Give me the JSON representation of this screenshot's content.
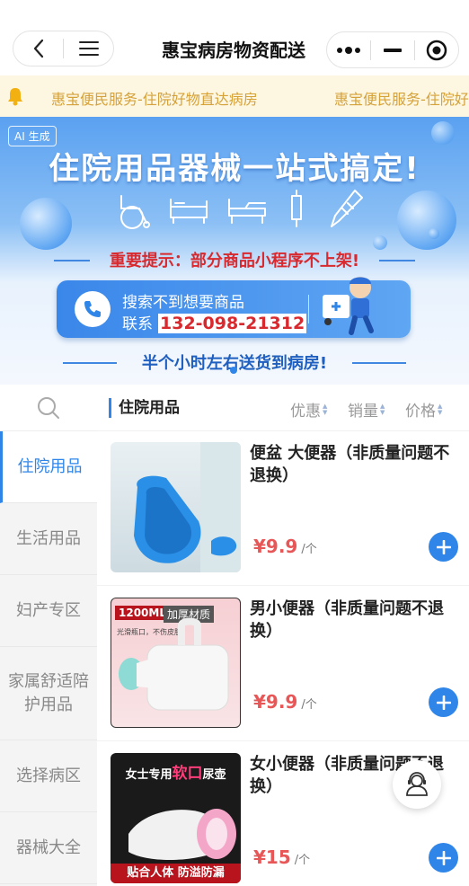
{
  "header": {
    "title": "惠宝病房物资配送"
  },
  "notice": {
    "text": "惠宝便民服务-住院好物直达病房",
    "text_repeat": "惠宝便民服务-住院好"
  },
  "banner": {
    "ai_tag": "AI 生成",
    "headline": "住院用品器械一站式搞定!",
    "warning": "重要提示：部分商品小程序不上架!",
    "contact_line1": "搜索不到想要商品",
    "contact_label": "联系",
    "contact_phone": "132-098-21312",
    "bottom": "半个小时左右送货到病房!"
  },
  "sidebar": {
    "items": [
      {
        "label": "住院用品",
        "active": true
      },
      {
        "label": "生活用品"
      },
      {
        "label": "妇产专区"
      },
      {
        "label": "家属舒适陪护用品"
      },
      {
        "label": "选择病区"
      },
      {
        "label": "器械大全"
      }
    ]
  },
  "content": {
    "category": "住院用品",
    "sort": [
      "优惠",
      "销量",
      "价格"
    ],
    "products": [
      {
        "name": "便盆 大便器（非质量问题不退换）",
        "price": "¥9.9",
        "unit": "/个"
      },
      {
        "name": "男小便器（非质量问题不退换）",
        "price": "¥9.9",
        "unit": "/个",
        "img_text_1": "1200ML",
        "img_text_2": "加厚材质",
        "img_text_3": "光滑瓶口，不伤皮肤"
      },
      {
        "name": "女小便器（非质量问题不退换）",
        "price": "¥15",
        "unit": "/个",
        "img_text_1": "女士专用",
        "img_text_2": "软口",
        "img_text_3": "尿壶",
        "img_text_4": "贴合人体 防溢防漏"
      }
    ]
  },
  "colors": {
    "accent": "#2f86e8",
    "price": "#e85757",
    "notice_text": "#d5a23a",
    "notice_bg": "#fdf6e1"
  }
}
